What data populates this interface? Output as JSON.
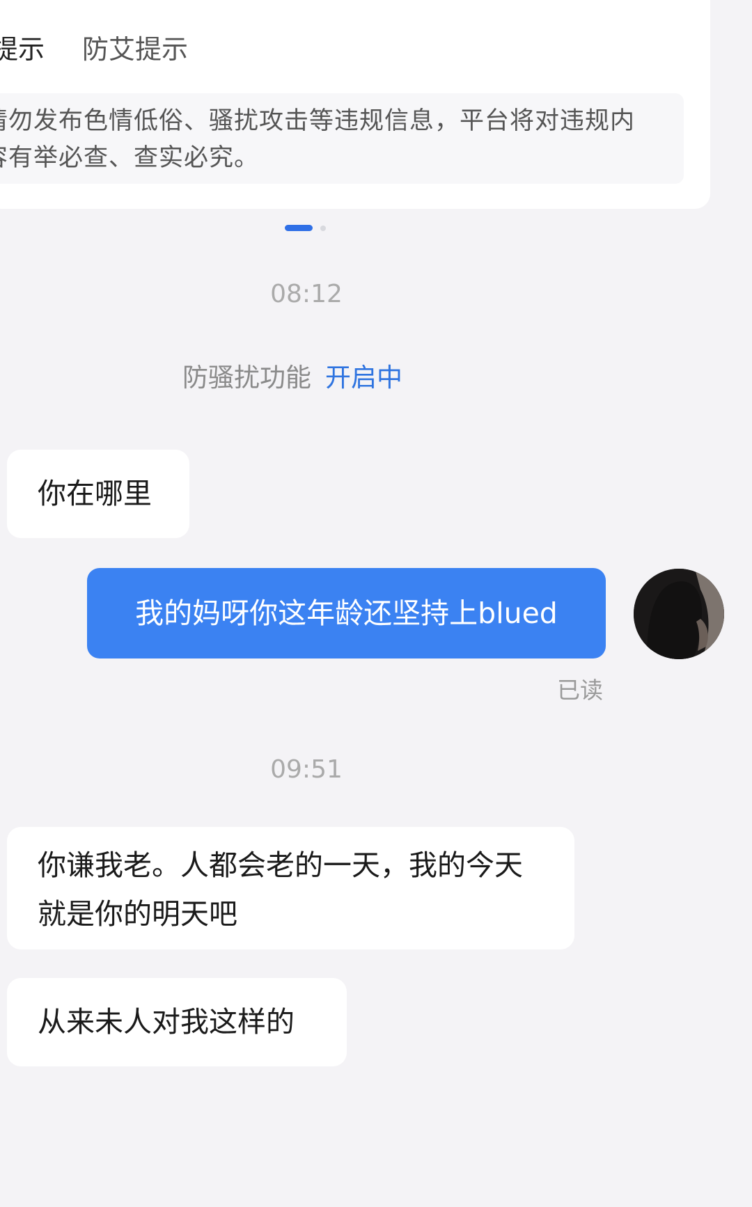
{
  "notice": {
    "tabs": [
      "提示",
      "防艾提示"
    ],
    "text": "请勿发布色情低俗、骚扰攻击等违规信息，平台将对违规内容有举必查、查实必究。"
  },
  "timestamps": [
    "08:12",
    "09:51"
  ],
  "system": {
    "label": "防骚扰功能",
    "status": "开启中",
    "status_color": "#2f74e0"
  },
  "messages": [
    {
      "side": "in",
      "text": "你在哪里"
    },
    {
      "side": "out",
      "text": "我的妈呀你这年龄还坚持上blued",
      "read_status": "已读"
    },
    {
      "side": "in",
      "text": "你谦我老。人都会老的一天，我的今天就是你的明天吧"
    },
    {
      "side": "in",
      "text": "从来未人对我这样的"
    }
  ],
  "colors": {
    "accent": "#3b82f2",
    "background": "#f4f3f6"
  },
  "icons": {
    "avatar": "user-avatar-photo"
  }
}
